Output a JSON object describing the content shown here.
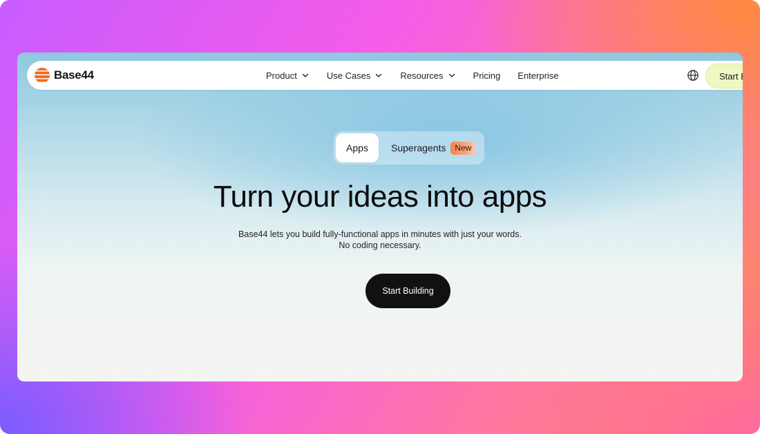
{
  "brand": {
    "name": "Base44"
  },
  "nav": {
    "items": [
      {
        "label": "Product",
        "has_dropdown": true
      },
      {
        "label": "Use Cases",
        "has_dropdown": true
      },
      {
        "label": "Resources",
        "has_dropdown": true
      },
      {
        "label": "Pricing",
        "has_dropdown": false
      },
      {
        "label": "Enterprise",
        "has_dropdown": false
      }
    ],
    "language_icon": "globe-icon",
    "cta_label": "Start B"
  },
  "hero": {
    "tabs": [
      {
        "label": "Apps",
        "selected": true
      },
      {
        "label": "Superagents",
        "selected": false,
        "badge": "New"
      }
    ],
    "headline": "Turn your ideas into apps",
    "subtext_line1": "Base44 lets you build fully-functional apps in minutes with just your words.",
    "subtext_line2": "No coding necessary.",
    "cta_label": "Start Building"
  },
  "colors": {
    "brand_orange": "#f26b1d",
    "cta_dark": "#111111",
    "nav_cta_bg": "#eef8c4",
    "badge_orange": "#f2874f"
  }
}
